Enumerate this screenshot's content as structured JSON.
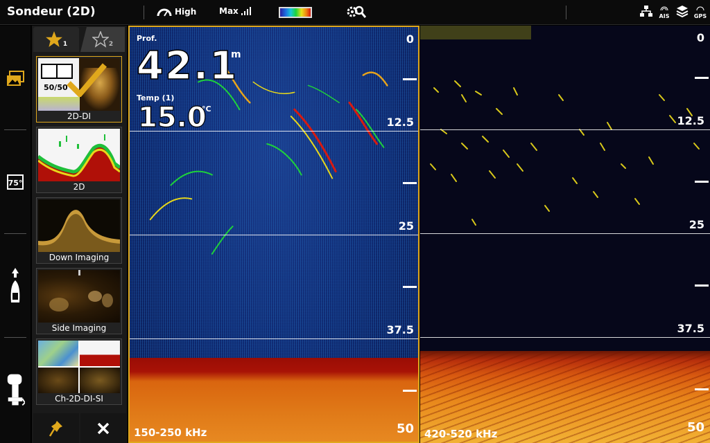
{
  "topbar": {
    "title": "Sondeur (2D)",
    "sensitivity_label": "High",
    "range_label": "Max",
    "icons": [
      "speed-gauge-icon",
      "signal-bars-icon",
      "color-palette",
      "settings-search-icon",
      "network-icon",
      "ais-icon",
      "layers-icon",
      "gps-icon"
    ],
    "ais_label": "AIS",
    "gps_label": "GPS",
    "palette_colors": [
      "#2a1fa0",
      "#1d6de0",
      "#19c8d8",
      "#1ed33a",
      "#e8e21a",
      "#f08a12",
      "#d81a10"
    ]
  },
  "rail": {
    "items": [
      {
        "icon": "views-icon"
      },
      {
        "icon": "temperature-gauge-icon",
        "label": "75°"
      },
      {
        "icon": "boat-icon"
      },
      {
        "icon": "outboard-motor-icon"
      }
    ],
    "accent": "#e0a81c"
  },
  "favorites": {
    "tab1_sub": "1",
    "tab2_sub": "2",
    "tiles": [
      {
        "label": "2D-DI",
        "badge": "50/50",
        "active": true
      },
      {
        "label": "2D",
        "active": false
      },
      {
        "label": "Down Imaging",
        "active": false
      },
      {
        "label": "Side Imaging",
        "active": false
      },
      {
        "label": "Ch-2D-DI-SI",
        "active": false
      }
    ],
    "footer": {
      "pin_icon": "pin-icon",
      "close_icon": "close-icon"
    }
  },
  "sonar": {
    "depth_label": "Prof.",
    "depth_value": "42.1",
    "depth_unit": "m",
    "temp_label": "Temp (1)",
    "temp_value": "15.0",
    "temp_unit": "°C",
    "scale": [
      "0",
      "12.5",
      "25",
      "37.5",
      "50"
    ],
    "left_freq": "150-250 kHz",
    "right_freq": "420-520 kHz"
  }
}
